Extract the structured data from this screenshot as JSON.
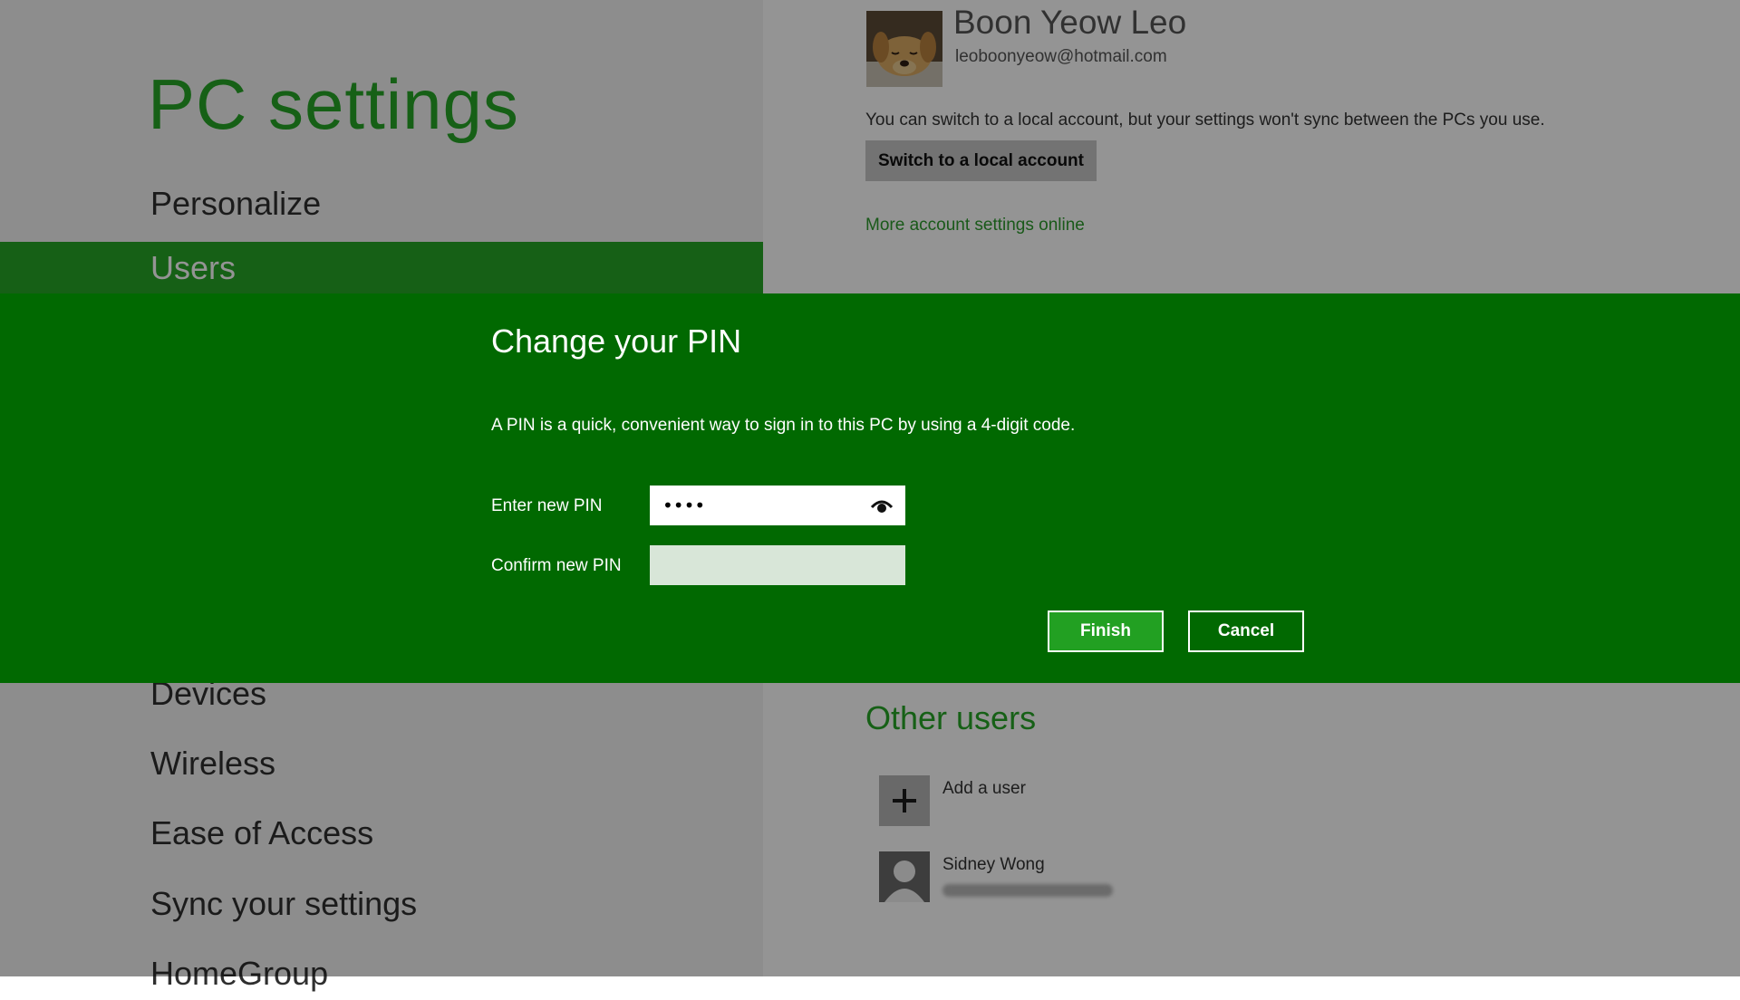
{
  "app": {
    "title": "PC settings"
  },
  "nav": {
    "items": [
      {
        "label": "Personalize",
        "selected": false
      },
      {
        "label": "Users",
        "selected": true
      },
      {
        "label": "Devices",
        "selected": false
      },
      {
        "label": "Wireless",
        "selected": false
      },
      {
        "label": "Ease of Access",
        "selected": false
      },
      {
        "label": "Sync your settings",
        "selected": false
      },
      {
        "label": "HomeGroup",
        "selected": false
      }
    ]
  },
  "account": {
    "name": "Boon Yeow Leo",
    "email": "leoboonyeow@hotmail.com",
    "switch_description": "You can switch to a local account, but your settings won't sync between the PCs you use.",
    "switch_button": "Switch to a local account",
    "online_link": "More account settings online"
  },
  "other_users": {
    "title": "Other users",
    "add_user_label": "Add a user",
    "users": [
      {
        "name": "Sidney Wong"
      }
    ]
  },
  "dialog": {
    "title": "Change your PIN",
    "description": "A PIN is a quick, convenient way to sign in to this PC by using a 4-digit code.",
    "new_pin_label": "Enter new PIN",
    "new_pin_value": "••••",
    "confirm_pin_label": "Confirm new PIN",
    "confirm_pin_value": "",
    "finish_button": "Finish",
    "cancel_button": "Cancel"
  },
  "colors": {
    "accent": "#26a626",
    "dialog_background": "#016901",
    "finish_button": "#22a022",
    "sidebar_background": "#f3f3f3"
  },
  "icons": {
    "reveal_password": "eye-icon",
    "add_user": "plus-icon",
    "user_avatar": "person-silhouette-icon",
    "account_avatar": "dog-photo"
  }
}
